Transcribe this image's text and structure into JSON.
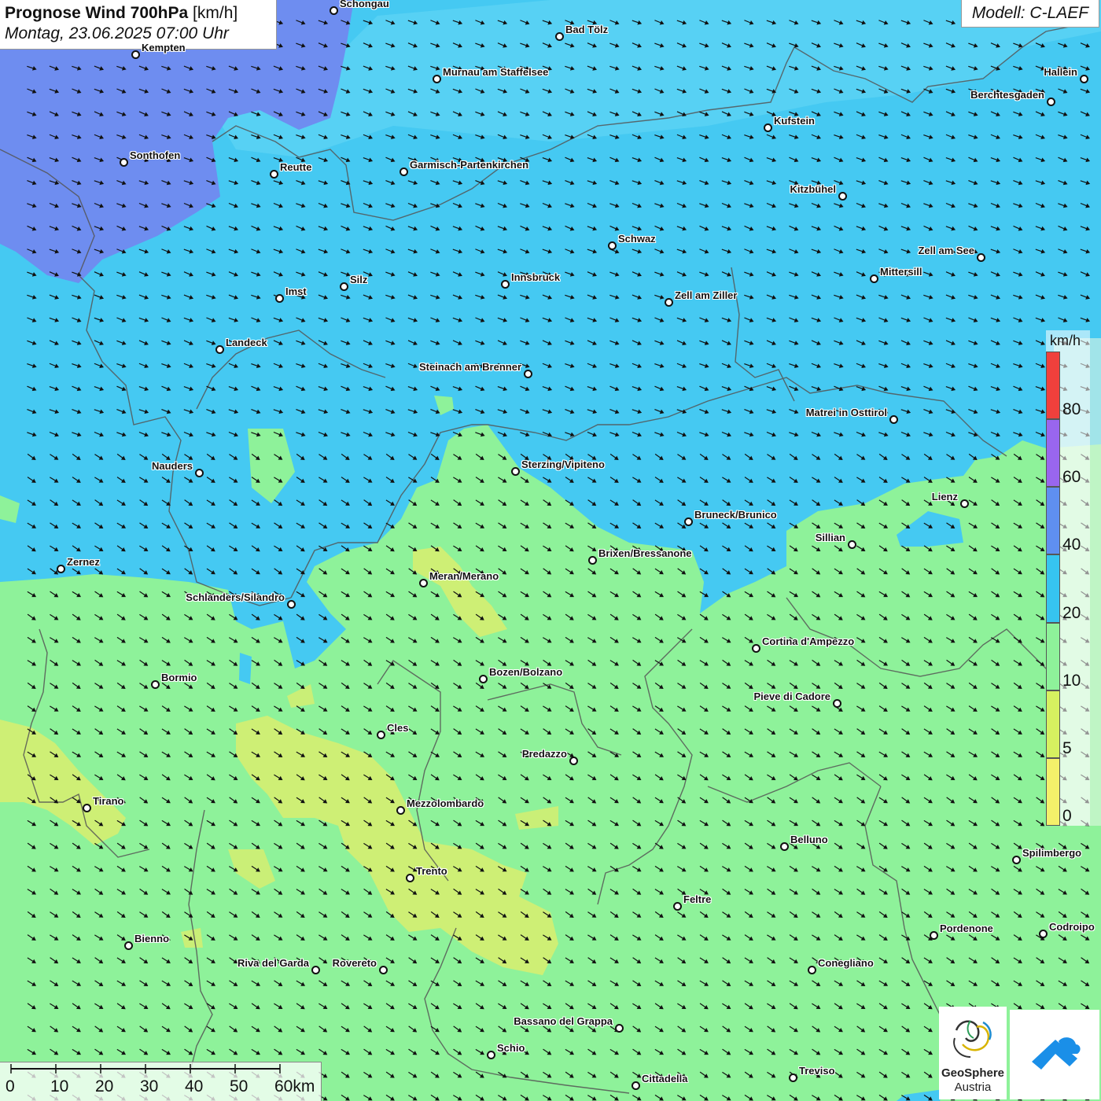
{
  "header": {
    "title_bold": "Prognose Wind 700hPa",
    "title_unit": "[km/h]",
    "datetime": "Montag, 23.06.2025 07:00 Uhr",
    "model": "Modell: C-LAEF"
  },
  "legend": {
    "unit": "km/h",
    "bands": [
      {
        "from": 0,
        "to": 5,
        "color": "#f4f06a"
      },
      {
        "from": 5,
        "to": 10,
        "color": "#d6f060"
      },
      {
        "from": 10,
        "to": 20,
        "color": "#8ef29a"
      },
      {
        "from": 20,
        "to": 40,
        "color": "#36c4f0"
      },
      {
        "from": 40,
        "to": 60,
        "color": "#5f8ff0"
      },
      {
        "from": 60,
        "to": 80,
        "color": "#9966ee"
      },
      {
        "from": 80,
        "to": 100,
        "color": "#f0403c"
      }
    ],
    "tick_labels": [
      "0",
      "5",
      "10",
      "20",
      "40",
      "60",
      "80"
    ]
  },
  "scale_bar": {
    "labels": [
      "0",
      "10",
      "20",
      "30",
      "40",
      "50",
      "60km"
    ]
  },
  "colors": {
    "calm": "#f4f06a",
    "light": "#8ef29a",
    "moderate": "#5cd6f4",
    "strong": "#5f8ff0",
    "border": "#555555"
  },
  "wind_direction": "northwest to southeast",
  "logos": {
    "geosphere_name": "GeoSphere",
    "geosphere_sub": "Austria"
  },
  "cities": [
    {
      "name": "Schongau"
    },
    {
      "name": "Bad Tölz"
    },
    {
      "name": "Kempten"
    },
    {
      "name": "Murnau am Staffelsee"
    },
    {
      "name": "Hallein"
    },
    {
      "name": "Berchtesgaden"
    },
    {
      "name": "Kufstein"
    },
    {
      "name": "Sonthofen"
    },
    {
      "name": "Reutte"
    },
    {
      "name": "Garmisch-Partenkirchen"
    },
    {
      "name": "Kitzbühel"
    },
    {
      "name": "Schwaz"
    },
    {
      "name": "Zell am See"
    },
    {
      "name": "Innsbruck"
    },
    {
      "name": "Mittersill"
    },
    {
      "name": "Silz"
    },
    {
      "name": "Imst"
    },
    {
      "name": "Zell am Ziller"
    },
    {
      "name": "Landeck"
    },
    {
      "name": "Steinach am Brenner"
    },
    {
      "name": "Matrei in Osttirol"
    },
    {
      "name": "Nauders"
    },
    {
      "name": "Sterzing/Vipiteno"
    },
    {
      "name": "Lienz"
    },
    {
      "name": "Bruneck/Brunico"
    },
    {
      "name": "Sillian"
    },
    {
      "name": "Brixen/Bressanone"
    },
    {
      "name": "Zernez"
    },
    {
      "name": "Meran/Merano"
    },
    {
      "name": "Schlanders/Silandro"
    },
    {
      "name": "Cortina d'Ampezzo"
    },
    {
      "name": "Bozen/Bolzano"
    },
    {
      "name": "Bormio"
    },
    {
      "name": "Pieve di Cadore"
    },
    {
      "name": "Cles"
    },
    {
      "name": "Predazzo"
    },
    {
      "name": "Tirano"
    },
    {
      "name": "Mezzolombardo"
    },
    {
      "name": "Belluno"
    },
    {
      "name": "Spilimbergo"
    },
    {
      "name": "Trento"
    },
    {
      "name": "Feltre"
    },
    {
      "name": "Pordenone"
    },
    {
      "name": "Codroipo"
    },
    {
      "name": "Bienno"
    },
    {
      "name": "Riva del Garda"
    },
    {
      "name": "Rovereto"
    },
    {
      "name": "Conegliano"
    },
    {
      "name": "Bassano del Grappa"
    },
    {
      "name": "Schio"
    },
    {
      "name": "Treviso"
    },
    {
      "name": "Cittadella"
    }
  ]
}
